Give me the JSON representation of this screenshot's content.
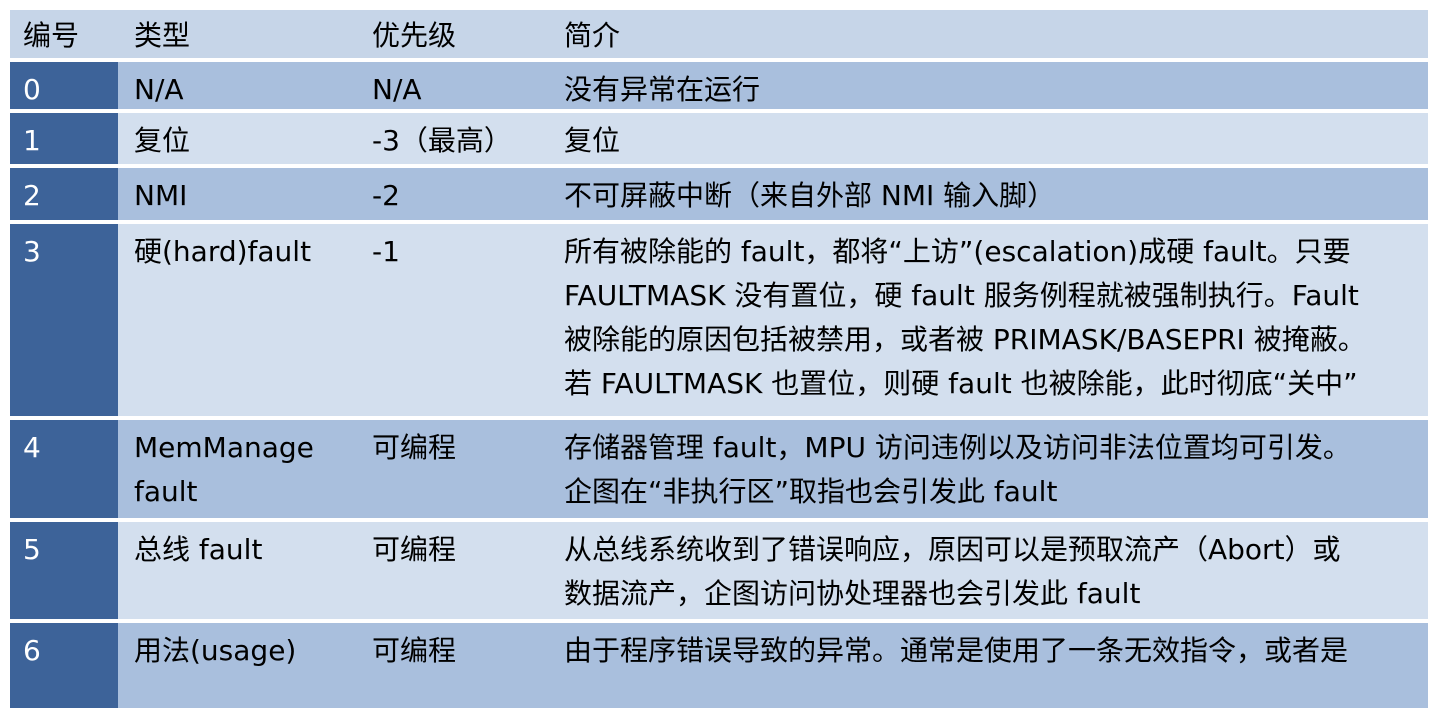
{
  "headers": [
    "编号",
    "类型",
    "优先级",
    "简介"
  ],
  "rows": [
    {
      "num": "0",
      "type": [
        "N/A"
      ],
      "priority": "N/A",
      "desc": [
        "没有异常在运行"
      ]
    },
    {
      "num": "1",
      "type": [
        "复位"
      ],
      "priority": "-3（最高）",
      "desc": [
        "复位"
      ]
    },
    {
      "num": "2",
      "type": [
        "NMI"
      ],
      "priority": "-2",
      "desc": [
        "不可屏蔽中断（来自外部 NMI 输入脚）"
      ]
    },
    {
      "num": "3",
      "type": [
        "硬(hard)fault"
      ],
      "priority": "-1",
      "desc": [
        "所有被除能的 fault，都将“上访”(escalation)成硬 fault。只要",
        "FAULTMASK 没有置位，硬 fault 服务例程就被强制执行。Fault",
        "被除能的原因包括被禁用，或者被 PRIMASK/BASEPRI 被掩蔽。",
        "若 FAULTMASK 也置位，则硬 fault 也被除能，此时彻底“关中”"
      ]
    },
    {
      "num": "4",
      "type": [
        "MemManage",
        "fault"
      ],
      "priority": "可编程",
      "desc": [
        "存储器管理 fault，MPU 访问违例以及访问非法位置均可引发。",
        "企图在“非执行区”取指也会引发此 fault"
      ]
    },
    {
      "num": "5",
      "type": [
        "总线 fault"
      ],
      "priority": "可编程",
      "desc": [
        "从总线系统收到了错误响应，原因可以是预取流产（Abort）或",
        "数据流产，企图访问协处理器也会引发此 fault"
      ]
    },
    {
      "num": "6",
      "type": [
        "用法(usage)"
      ],
      "priority": "可编程",
      "desc": [
        "由于程序错误导致的异常。通常是使用了一条无效指令，或者是"
      ]
    }
  ],
  "colors": {
    "header_bg": "#c6d5e8",
    "row_dark_bg": "#a9bfdd",
    "row_light_bg": "#d3dfee",
    "num_col_bg": "#3d6399",
    "num_col_text": "#ffffff"
  }
}
